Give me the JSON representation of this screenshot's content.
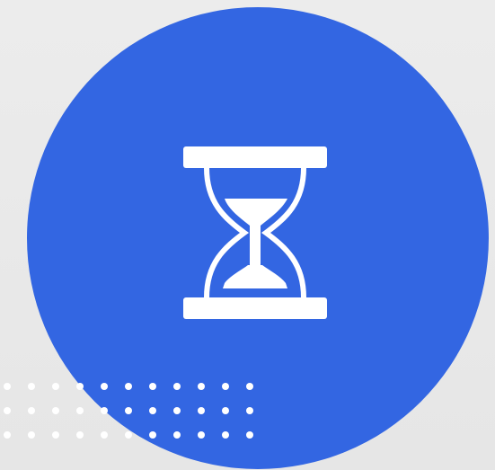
{
  "graphic": {
    "icon": "hourglass-icon",
    "colors": {
      "background": "#e9e9e9",
      "circle": "#3366e2",
      "icon": "#ffffff",
      "dots": "#ffffff"
    },
    "dot_grid": {
      "rows": 3,
      "columns": 11
    }
  }
}
